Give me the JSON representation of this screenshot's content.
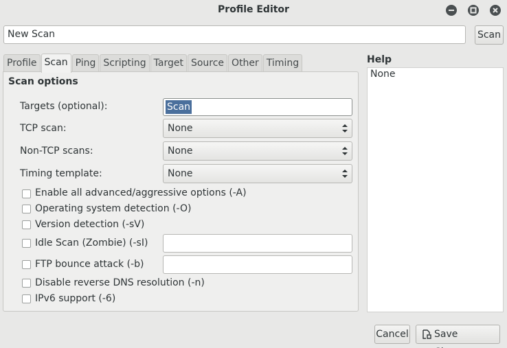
{
  "window": {
    "title": "Profile Editor",
    "controls": [
      "minimize-icon",
      "maximize-icon",
      "close-icon"
    ]
  },
  "profile": {
    "name_value": "New Scan",
    "scan_button": "Scan"
  },
  "tabs": [
    {
      "label": "Profile",
      "active": false
    },
    {
      "label": "Scan",
      "active": true
    },
    {
      "label": "Ping",
      "active": false
    },
    {
      "label": "Scripting",
      "active": false
    },
    {
      "label": "Target",
      "active": false
    },
    {
      "label": "Source",
      "active": false
    },
    {
      "label": "Other",
      "active": false
    },
    {
      "label": "Timing",
      "active": false
    }
  ],
  "scan_options": {
    "section_title": "Scan options",
    "targets_label": "Targets (optional):",
    "targets_value": "Scan",
    "tcp_scan_label": "TCP scan:",
    "tcp_scan_value": "None",
    "non_tcp_label": "Non-TCP scans:",
    "non_tcp_value": "None",
    "timing_label": "Timing template:",
    "timing_value": "None",
    "checkboxes": [
      {
        "label": "Enable all advanced/aggressive options (-A)",
        "checked": false
      },
      {
        "label": "Operating system detection (-O)",
        "checked": false
      },
      {
        "label": "Version detection (-sV)",
        "checked": false
      },
      {
        "label": "Idle Scan (Zombie) (-sI)",
        "checked": false
      },
      {
        "label": "FTP bounce attack (-b)",
        "checked": false
      },
      {
        "label": "Disable reverse DNS resolution (-n)",
        "checked": false
      },
      {
        "label": "IPv6 support (-6)",
        "checked": false
      }
    ],
    "idle_scan_value": "",
    "ftp_bounce_value": ""
  },
  "help": {
    "title": "Help",
    "text": "None"
  },
  "footer": {
    "cancel_label": "Cancel",
    "save_label": "Save Changes"
  }
}
